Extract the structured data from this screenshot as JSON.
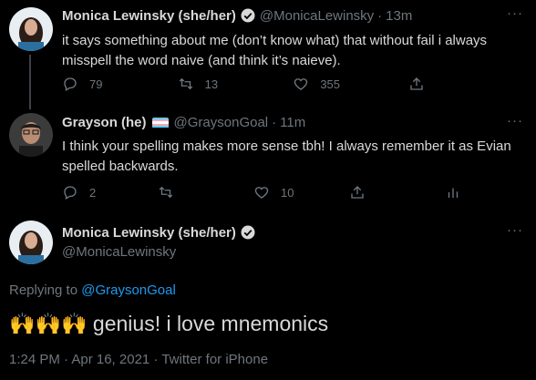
{
  "tweets": [
    {
      "name": "Monica Lewinsky (she/her)",
      "handle": "@MonicaLewinsky",
      "sep": "·",
      "time": "13m",
      "text": "it says something about me (don’t know what) that without fail i always misspell the word naive (and think it’s naieve).",
      "actions": {
        "replies": "79",
        "retweets": "13",
        "likes": "355"
      }
    },
    {
      "name": "Grayson (he)",
      "handle": "@GraysonGoal",
      "sep": "·",
      "time": "11m",
      "text": "I think your spelling makes more sense tbh! I always remember it as Evian spelled backwards.",
      "actions": {
        "replies": "2",
        "retweets": "",
        "likes": "10"
      }
    }
  ],
  "main": {
    "name": "Monica Lewinsky (she/her)",
    "handle": "@MonicaLewinsky",
    "replying_prefix": "Replying to",
    "replying_to": "@GraysonGoal",
    "text": "genius! i love mnemonics",
    "emoji": "🙌🙌🙌",
    "meta": "1:24 PM · Apr 16, 2021 · Twitter for iPhone"
  },
  "colors": {
    "background": "#000000",
    "text": "#d9d9d9",
    "muted": "#6e767d",
    "link": "#1d9bf0",
    "verified": "#d9d9d9"
  },
  "icons": [
    "reply-icon",
    "retweet-icon",
    "like-icon",
    "share-icon",
    "analytics-icon",
    "verified-badge-icon",
    "more-icon",
    "transgender-flag-emoji",
    "raised-hands-emoji"
  ]
}
